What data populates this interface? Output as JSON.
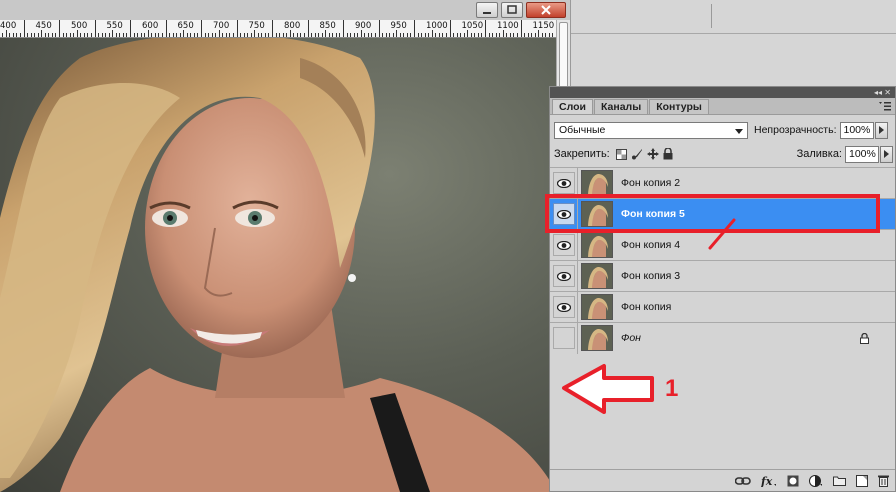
{
  "window": {
    "controls": [
      {
        "icon": "minimize-icon"
      },
      {
        "icon": "maximize-icon"
      },
      {
        "icon": "close-icon"
      }
    ]
  },
  "ruler": {
    "labels": [
      "400",
      "450",
      "500",
      "550",
      "600",
      "650",
      "700",
      "750",
      "800",
      "850",
      "900",
      "950",
      "1000",
      "1050",
      "1100",
      "1150"
    ]
  },
  "layers_panel": {
    "tabs": [
      "Слои",
      "Каналы",
      "Контуры"
    ],
    "active_tab": "Слои",
    "blend_mode": "Обычные",
    "opacity_label": "Непрозрачность:",
    "opacity_value": "100%",
    "lock_label": "Закрепить:",
    "fill_label": "Заливка:",
    "fill_value": "100%",
    "layers": [
      {
        "name": "Фон копия 2",
        "visible": true,
        "selected": false
      },
      {
        "name": "Фон копия 5",
        "visible": true,
        "selected": true
      },
      {
        "name": "Фон копия 4",
        "visible": true,
        "selected": false
      },
      {
        "name": "Фон копия 3",
        "visible": true,
        "selected": false
      },
      {
        "name": "Фон копия",
        "visible": true,
        "selected": false
      },
      {
        "name": "Фон",
        "visible": false,
        "selected": false,
        "locked": true
      }
    ],
    "bottom_icons": [
      "link-icon",
      "fx-icon",
      "mask-icon",
      "adjustment-icon",
      "group-icon",
      "new-layer-icon",
      "trash-icon"
    ]
  },
  "annotation": {
    "number": "1",
    "color": "#e8202a"
  },
  "colors": {
    "selection": "#3b8ef2",
    "panel_bg": "#d4d4d4"
  }
}
